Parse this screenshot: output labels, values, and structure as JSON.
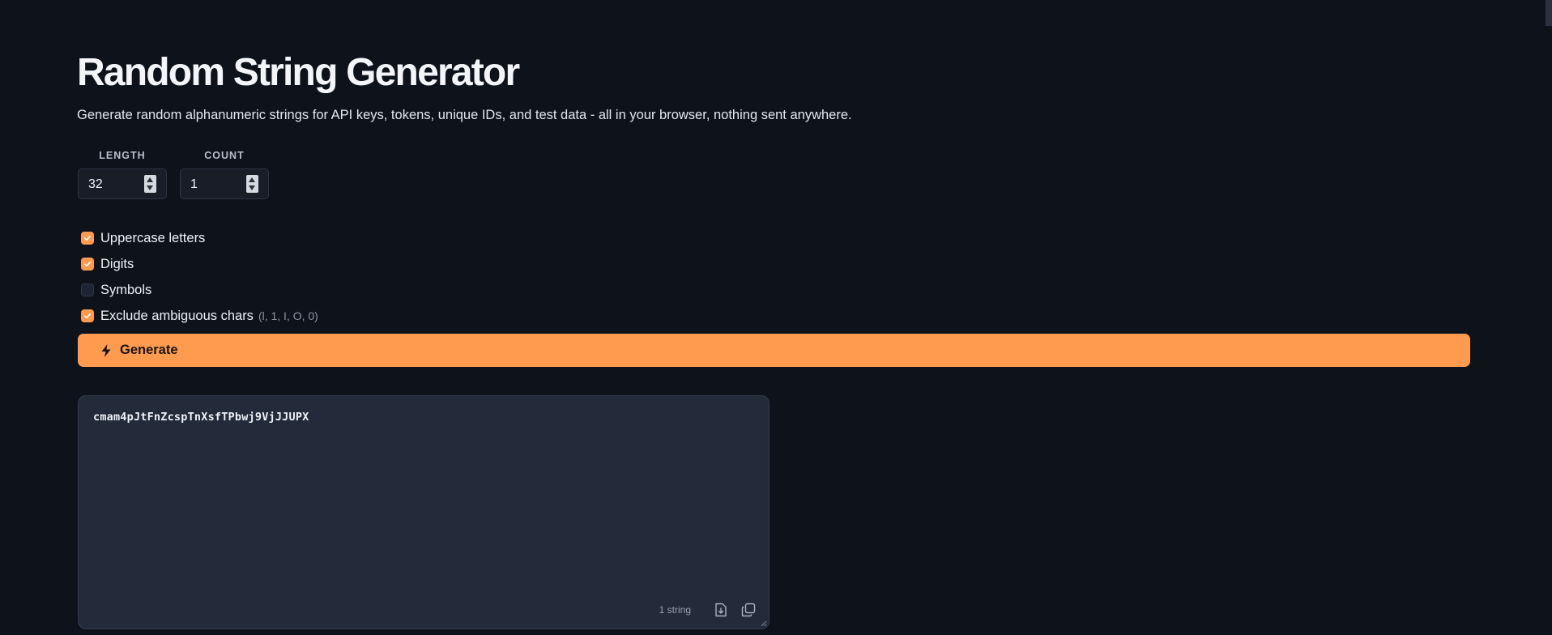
{
  "page": {
    "title": "Random String Generator",
    "subtitle": "Generate random alphanumeric strings for API keys, tokens, unique IDs, and test data - all in your browser, nothing sent anywhere."
  },
  "fields": {
    "length": {
      "label": "LENGTH",
      "value": "32"
    },
    "count": {
      "label": "COUNT",
      "value": "1"
    }
  },
  "options": [
    {
      "label": "Uppercase letters",
      "checked": true,
      "hint": ""
    },
    {
      "label": "Digits",
      "checked": true,
      "hint": ""
    },
    {
      "label": "Symbols",
      "checked": false,
      "hint": ""
    },
    {
      "label": "Exclude ambiguous chars",
      "checked": true,
      "hint": "(l, 1, I, O, 0)"
    }
  ],
  "generate": {
    "label": "Generate",
    "icon": "bolt-icon"
  },
  "output": {
    "value": "cmam4pJtFnZcspTnXsfTPbwj9VjJJUPX",
    "count_text": "1 string",
    "download_icon": "download-icon",
    "copy_icon": "copy-icon"
  },
  "colors": {
    "background": "#0e121b",
    "accent": "#ff9b4e",
    "output_bg": "#232b3b"
  }
}
